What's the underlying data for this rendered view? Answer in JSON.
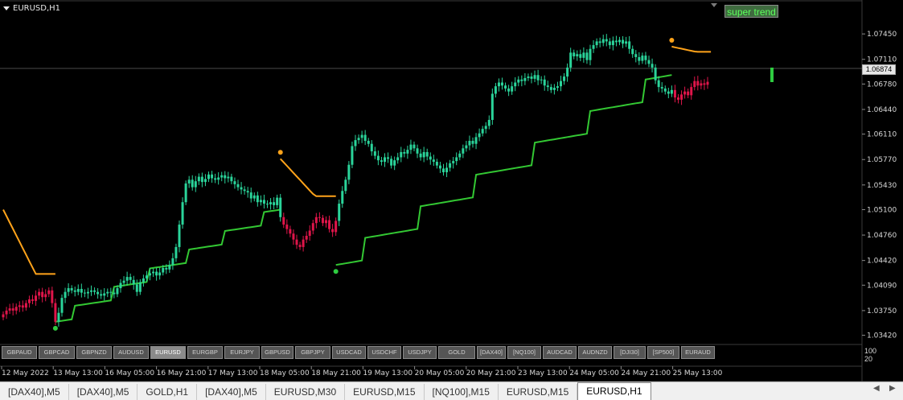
{
  "window": {
    "symbol_title": "EURUSD,H1"
  },
  "indicator": {
    "button_label": "super trend"
  },
  "colors": {
    "background": "#000000",
    "grid": "#3a3a3a",
    "bull": "#2ad49a",
    "bear": "#e0154a",
    "trend_up": "#33c833",
    "trend_down": "#ffa31a",
    "axis_text": "#d8d8d8",
    "dot": "#2ecc40",
    "dot_orange": "#ffa31a"
  },
  "price_axis": {
    "ticks": [
      "1.07450",
      "1.07110",
      "1.06780",
      "1.06440",
      "1.06110",
      "1.05770",
      "1.05430",
      "1.05100",
      "1.04760",
      "1.04420",
      "1.04090",
      "1.03750",
      "1.03420"
    ],
    "current_price": "1.06874"
  },
  "time_axis": {
    "labels": [
      "12 May 2022",
      "13 May 13:00",
      "16 May 05:00",
      "16 May 21:00",
      "17 May 13:00",
      "18 May 05:00",
      "18 May 21:00",
      "19 May 13:00",
      "20 May 05:00",
      "20 May 21:00",
      "23 May 13:00",
      "24 May 05:00",
      "24 May 21:00",
      "25 May 13:00"
    ]
  },
  "subwindow": {
    "levels": [
      "100",
      "20"
    ]
  },
  "symbol_buttons": [
    {
      "label": "GBPAUD",
      "active": false
    },
    {
      "label": "GBPCAD",
      "active": false
    },
    {
      "label": "GBPNZD",
      "active": false
    },
    {
      "label": "AUDUSD",
      "active": false
    },
    {
      "label": "EURUSD",
      "active": true
    },
    {
      "label": "EURGBP",
      "active": false
    },
    {
      "label": "EURJPY",
      "active": false
    },
    {
      "label": "GBPUSD",
      "active": false
    },
    {
      "label": "GBPJPY",
      "active": false
    },
    {
      "label": "USDCAD",
      "active": false
    },
    {
      "label": "USDCHF",
      "active": false
    },
    {
      "label": "USDJPY",
      "active": false
    },
    {
      "label": "GOLD",
      "active": false
    },
    {
      "label": "[DAX40]",
      "active": false
    },
    {
      "label": "[NQ100]",
      "active": false
    },
    {
      "label": "AUDCAD",
      "active": false
    },
    {
      "label": "AUDNZD",
      "active": false
    },
    {
      "label": "[DJI30]",
      "active": false
    },
    {
      "label": "[SP500]",
      "active": false
    },
    {
      "label": "EURAUD",
      "active": false
    }
  ],
  "chart_tabs": [
    {
      "label": "[DAX40],M5",
      "active": false
    },
    {
      "label": "[DAX40],M5",
      "active": false
    },
    {
      "label": "GOLD,H1",
      "active": false
    },
    {
      "label": "[DAX40],M5",
      "active": false
    },
    {
      "label": "EURUSD,M30",
      "active": false
    },
    {
      "label": "EURUSD,M15",
      "active": false
    },
    {
      "label": "[NQ100],M15",
      "active": false
    },
    {
      "label": "EURUSD,M15",
      "active": false
    },
    {
      "label": "EURUSD,H1",
      "active": true
    }
  ],
  "chart_data": {
    "type": "candlestick",
    "title": "EURUSD,H1",
    "ylim": [
      1.0334,
      1.0757
    ],
    "close": [
      1.037,
      1.0375,
      1.0378,
      1.0375,
      1.038,
      1.0382,
      1.0379,
      1.0385,
      1.039,
      1.0388,
      1.0395,
      1.04,
      1.0393,
      1.0397,
      1.0402,
      1.0385,
      1.036,
      1.0372,
      1.0392,
      1.04,
      1.0405,
      1.0402,
      1.04,
      1.0404,
      1.0399,
      1.0398,
      1.04,
      1.0402,
      1.04,
      1.0397,
      1.0395,
      1.0398,
      1.04,
      1.0399,
      1.0397,
      1.0405,
      1.0412,
      1.0415,
      1.042,
      1.0416,
      1.041,
      1.04,
      1.0413,
      1.0418,
      1.0422,
      1.0425,
      1.0427,
      1.0422,
      1.0426,
      1.0432,
      1.043,
      1.0436,
      1.0445,
      1.046,
      1.049,
      1.052,
      1.0545,
      1.055,
      1.054,
      1.0548,
      1.0554,
      1.0547,
      1.0551,
      1.0557,
      1.0552,
      1.055,
      1.0553,
      1.0556,
      1.0552,
      1.0554,
      1.0548,
      1.0544,
      1.054,
      1.0537,
      1.0535,
      1.0533,
      1.0525,
      1.0529,
      1.052,
      1.0523,
      1.0518,
      1.0517,
      1.052,
      1.0516,
      1.0526,
      1.05,
      1.049,
      1.0484,
      1.0478,
      1.047,
      1.0463,
      1.046,
      1.047,
      1.0475,
      1.0482,
      1.0492,
      1.05,
      1.0499,
      1.0492,
      1.0496,
      1.0484,
      1.048,
      1.0495,
      1.0518,
      1.0535,
      1.055,
      1.057,
      1.0595,
      1.0603,
      1.0606,
      1.061,
      1.0602,
      1.0598,
      1.0588,
      1.0582,
      1.0576,
      1.0574,
      1.058,
      1.0578,
      1.0569,
      1.0576,
      1.058,
      1.0587,
      1.0585,
      1.059,
      1.0597,
      1.0592,
      1.0585,
      1.058,
      1.0587,
      1.0581,
      1.0577,
      1.0574,
      1.0569,
      1.0565,
      1.056,
      1.0566,
      1.0572,
      1.0575,
      1.058,
      1.0585,
      1.0592,
      1.0596,
      1.0602,
      1.0598,
      1.0607,
      1.0612,
      1.0618,
      1.0622,
      1.063,
      1.0665,
      1.0675,
      1.068,
      1.0676,
      1.0672,
      1.0668,
      1.0675,
      1.068,
      1.0684,
      1.0682,
      1.0686,
      1.0688,
      1.0685,
      1.069,
      1.0683,
      1.0684,
      1.0676,
      1.0674,
      1.067,
      1.0673,
      1.0675,
      1.0682,
      1.0688,
      1.07,
      1.072,
      1.0715,
      1.0718,
      1.0713,
      1.072,
      1.071,
      1.0725,
      1.073,
      1.0735,
      1.0733,
      1.0738,
      1.0735,
      1.073,
      1.0736,
      1.0734,
      1.0737,
      1.0732,
      1.0735,
      1.0725,
      1.0718,
      1.0714,
      1.0709,
      1.0716,
      1.071,
      1.0705,
      1.07,
      1.0683,
      1.0674,
      1.0672,
      1.0668,
      1.0665,
      1.067,
      1.066,
      1.0657,
      1.0664,
      1.0668,
      1.0663,
      1.0674,
      1.0682,
      1.0676,
      1.0679,
      1.0677,
      1.0681
    ],
    "supertrend": [
      {
        "from": 0,
        "to": 16,
        "trend": "down",
        "start": 1.051,
        "end": 1.0424
      },
      {
        "from": 16,
        "to": 85,
        "trend": "up",
        "start": 1.036,
        "end": 1.051
      },
      {
        "from": 85,
        "to": 102,
        "trend": "down",
        "start": 1.0578,
        "end": 1.0528
      },
      {
        "from": 102,
        "to": 205,
        "trend": "up",
        "start": 1.0436,
        "end": 1.069
      },
      {
        "from": 205,
        "to": 217,
        "trend": "down",
        "start": 1.0728,
        "end": 1.0721
      }
    ]
  }
}
